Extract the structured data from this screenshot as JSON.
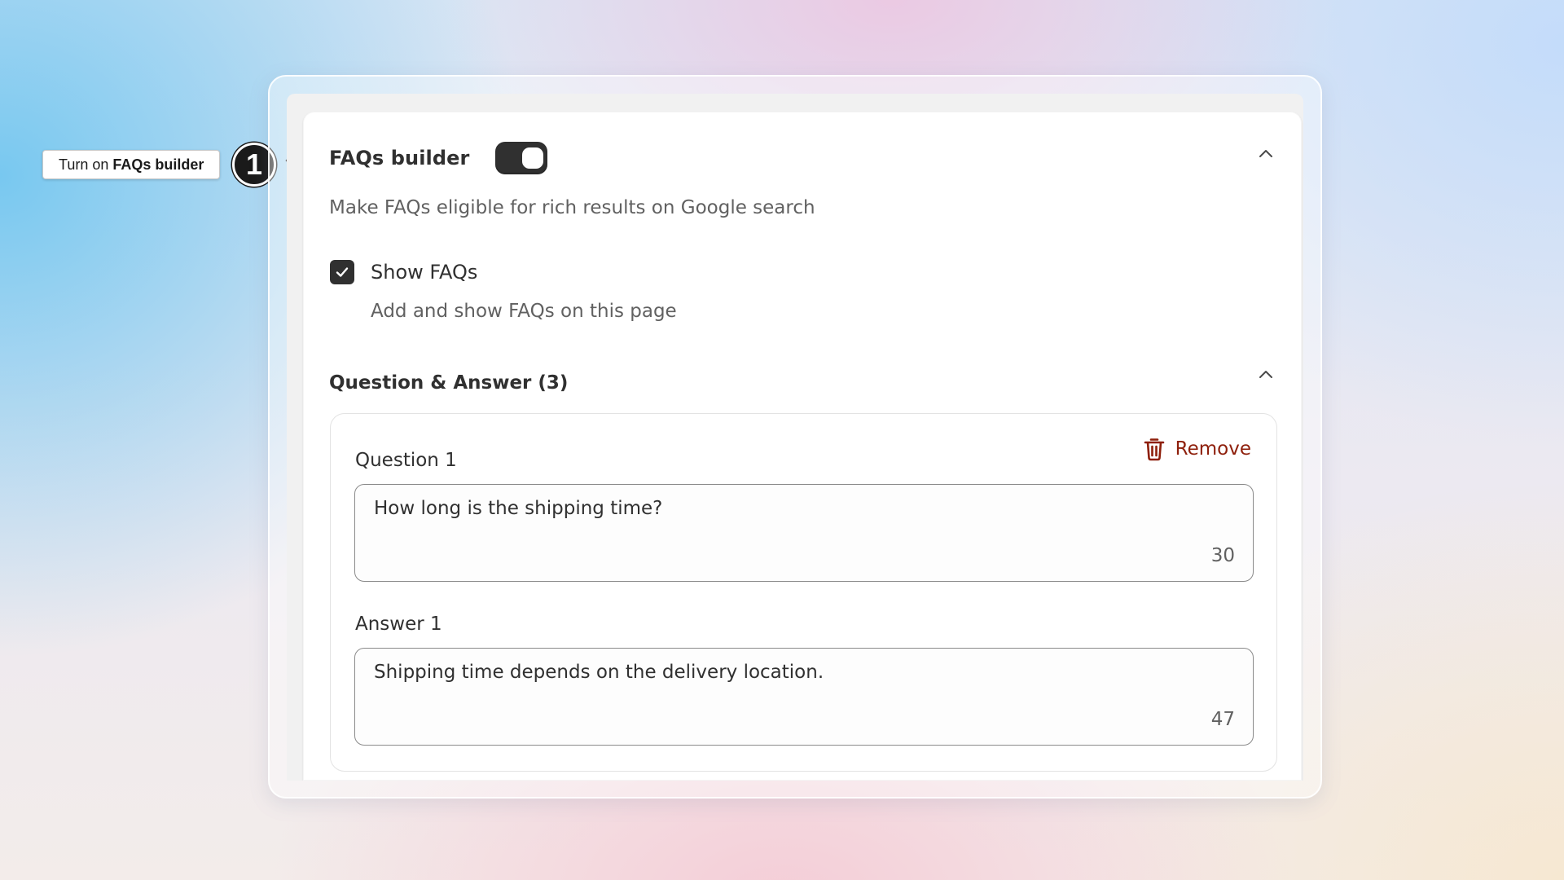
{
  "callout": {
    "prefix": "Turn on",
    "emphasis": "FAQs builder"
  },
  "step": {
    "number": "1"
  },
  "icons": {
    "pointer": "send-arrow-icon",
    "collapse": "chevron-up-icon",
    "check": "checkmark-icon",
    "remove": "trash-icon"
  },
  "faq_builder": {
    "title": "FAQs builder",
    "enabled": true,
    "description": "Make FAQs eligible for rich results on Google search",
    "show_faqs": {
      "label": "Show FAQs",
      "checked": true,
      "help": "Add and show FAQs on this page"
    },
    "qa_section": {
      "title": "Question & Answer (3)",
      "items": [
        {
          "question_label": "Question 1",
          "question_value": "How long is the shipping time?",
          "question_count": "30",
          "answer_label": "Answer 1",
          "answer_value": "Shipping time depends on the delivery location.",
          "answer_count": "47",
          "remove_label": "Remove"
        }
      ]
    }
  },
  "colors": {
    "toggle_on": "#303030",
    "remove_text": "#8e1f0b",
    "text_primary": "#303030",
    "text_secondary": "#616161"
  }
}
